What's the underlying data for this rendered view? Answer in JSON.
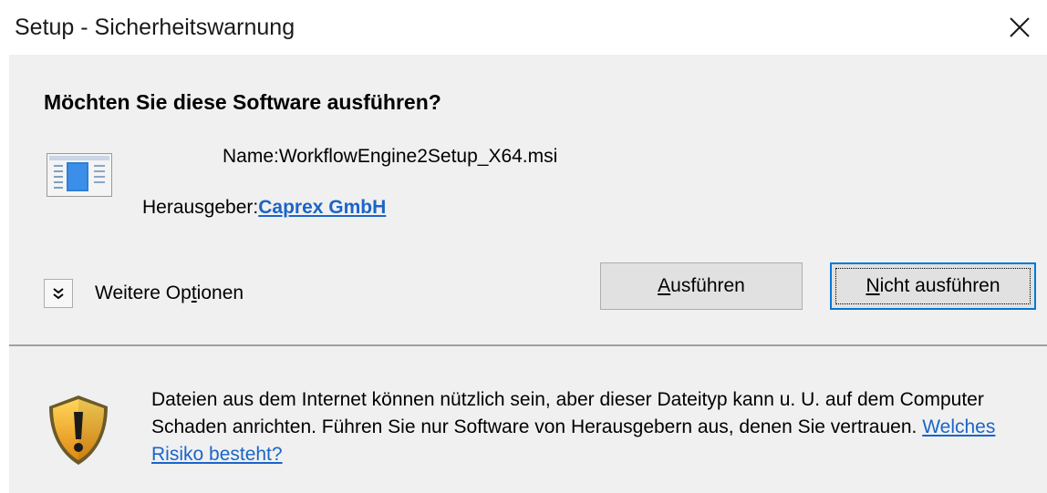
{
  "window": {
    "title": "Setup - Sicherheitswarnung",
    "close_icon": "close-icon"
  },
  "dialog": {
    "question": "Möchten Sie diese Software ausführen?",
    "app_icon": "installer-package-icon",
    "name_label": "Name:",
    "name_value": "WorkflowEngine2Setup_X64.msi",
    "publisher_label": "Herausgeber:",
    "publisher_value": "Caprex GmbH",
    "more_options": {
      "icon": "chevron-double-down-icon",
      "label_before": "Weitere Op",
      "label_accel": "t",
      "label_after": "ionen"
    },
    "run_button": {
      "accel": "A",
      "rest": "usführen"
    },
    "dont_run_button": {
      "accel": "N",
      "rest": "icht ausführen"
    }
  },
  "warning": {
    "icon": "warning-shield-icon",
    "text": "Dateien aus dem Internet können nützlich sein, aber dieser Dateityp kann u. U. auf dem Computer Schaden anrichten. Führen Sie nur Software von Herausgebern aus, denen Sie vertrauen. ",
    "link": "Welches Risiko besteht?"
  },
  "colors": {
    "link": "#1b65c8",
    "focus_border": "#0078d7",
    "panel_bg": "#f0f0f0",
    "button_bg": "#e1e1e1"
  }
}
